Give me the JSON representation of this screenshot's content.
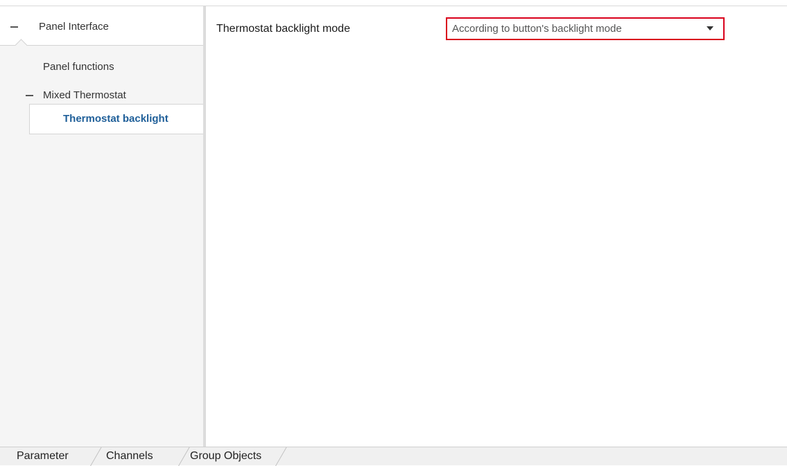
{
  "tree": {
    "root_label": "Panel Interface",
    "items": [
      {
        "label": "Panel functions"
      },
      {
        "label": "Mixed Thermostat"
      }
    ],
    "selected_label": "Thermostat backlight"
  },
  "content": {
    "param_label": "Thermostat backlight mode",
    "dropdown_value": "According to button's backlight mode"
  },
  "tabs": [
    {
      "label": "Parameter"
    },
    {
      "label": "Channels"
    },
    {
      "label": "Group Objects"
    }
  ],
  "colors": {
    "selected_text": "#1f5f99",
    "highlight_border": "#d9001b"
  }
}
